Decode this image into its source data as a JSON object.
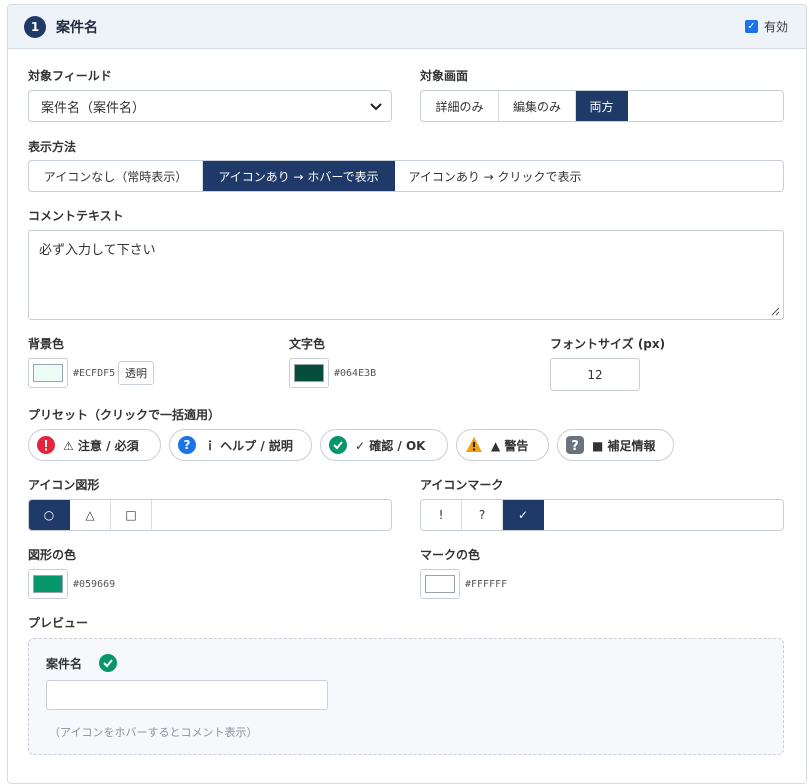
{
  "header": {
    "step_number": "1",
    "title": "案件名",
    "enabled_label": "有効",
    "enabled": true
  },
  "target_field": {
    "label": "対象フィールド",
    "value": "案件名（案件名）"
  },
  "target_screen": {
    "label": "対象画面",
    "options": [
      "詳細のみ",
      "編集のみ",
      "両方"
    ],
    "selected": "両方"
  },
  "display_method": {
    "label": "表示方法",
    "options": [
      "アイコンなし（常時表示）",
      "アイコンあり → ホバーで表示",
      "アイコンあり → クリックで表示"
    ],
    "selected": "アイコンあり → ホバーで表示"
  },
  "comment_text": {
    "label": "コメントテキスト",
    "value": "必ず入力して下さい"
  },
  "bg_color": {
    "label": "背景色",
    "hex": "#ECFDF5",
    "transparent_label": "透明"
  },
  "text_color": {
    "label": "文字色",
    "hex": "#064E3B"
  },
  "font_size": {
    "label": "フォントサイズ (px)",
    "value": "12"
  },
  "presets": {
    "label": "プリセット（クリックで一括適用）",
    "items": [
      {
        "label": "⚠ 注意 / 必須",
        "icon": "red-exclamation-icon",
        "color": "#e5243b"
      },
      {
        "label": "ｉ ヘルプ / 説明",
        "icon": "blue-question-icon",
        "color": "#1a73e8"
      },
      {
        "label": "✓ 確認 / OK",
        "icon": "green-check-icon",
        "color": "#059669"
      },
      {
        "label": "▲ 警告",
        "icon": "orange-warning-icon",
        "color": "#f59e0b"
      },
      {
        "label": "■ 補足情報",
        "icon": "gray-question-icon",
        "color": "#6b7280"
      }
    ]
  },
  "icon_shape": {
    "label": "アイコン図形",
    "options": [
      "○",
      "△",
      "□"
    ],
    "selected": "○"
  },
  "icon_mark": {
    "label": "アイコンマーク",
    "options": [
      "!",
      "?",
      "✓"
    ],
    "selected": "✓"
  },
  "shape_color": {
    "label": "図形の色",
    "hex": "#059669"
  },
  "mark_color": {
    "label": "マークの色",
    "hex": "#FFFFFF"
  },
  "preview": {
    "label": "プレビュー",
    "field_label": "案件名",
    "hint": "（アイコンをホバーするとコメント表示）"
  }
}
